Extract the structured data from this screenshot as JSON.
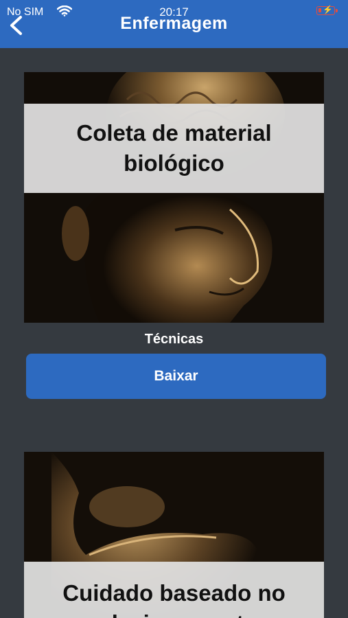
{
  "status_bar": {
    "carrier": "No SIM",
    "time": "20:17"
  },
  "header": {
    "title": "Enfermagem"
  },
  "items": [
    {
      "image_title": "Coleta de material biológico",
      "category": "Técnicas",
      "button_label": "Baixar"
    },
    {
      "image_title": "Cuidado baseado no relacionamento"
    }
  ],
  "colors": {
    "header_bg": "#2d6ac0",
    "page_bg": "#353a40",
    "button_bg": "#2d6ac0",
    "battery": "#e74c3c"
  }
}
